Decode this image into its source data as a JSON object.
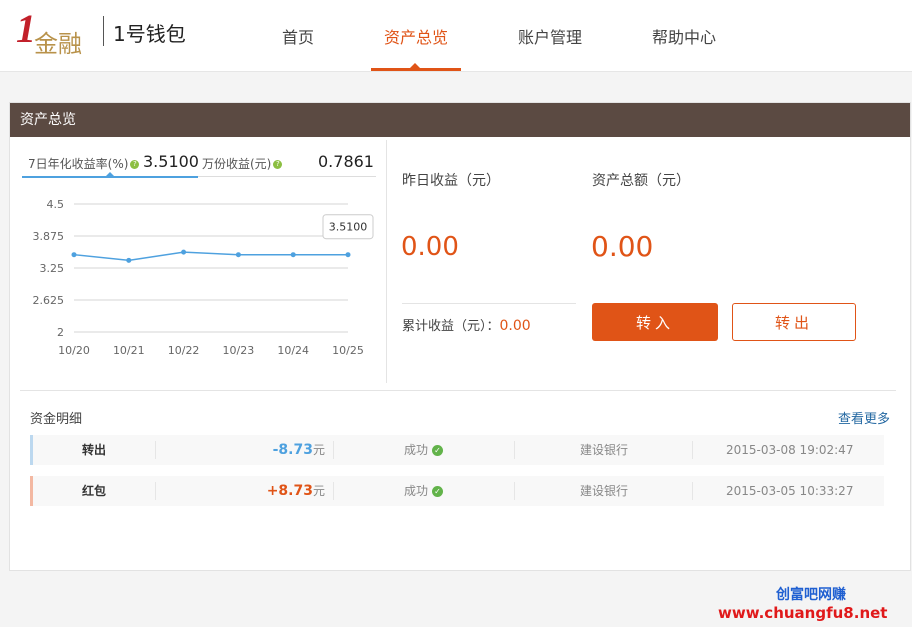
{
  "header": {
    "logo_text": "1金融",
    "brand": "1号钱包",
    "nav": [
      {
        "label": "首页",
        "active": false
      },
      {
        "label": "资产总览",
        "active": true
      },
      {
        "label": "账户管理",
        "active": false
      },
      {
        "label": "帮助中心",
        "active": false
      }
    ]
  },
  "panel": {
    "title": "资产总览",
    "yield_tab": {
      "label": "7日年化收益率(%)",
      "value": "3.5100"
    },
    "income_tab": {
      "label": "万份收益(元)",
      "value": "0.7861"
    },
    "yesterday_label": "昨日收益（元）",
    "yesterday_value": "0.00",
    "total_label": "资产总额（元）",
    "total_value": "0.00",
    "accum_label": "累计收益（元）：",
    "accum_value": "0.00",
    "btn_in": "转入",
    "btn_out": "转出"
  },
  "chart_data": {
    "type": "line",
    "x": [
      "10/20",
      "10/21",
      "10/22",
      "10/23",
      "10/24",
      "10/25"
    ],
    "series": [
      {
        "values": [
          3.51,
          3.4,
          3.56,
          3.51,
          3.51,
          3.51
        ]
      }
    ],
    "yticks": [
      "4.5",
      "3.875",
      "3.25",
      "2.625",
      "2"
    ],
    "ylim": [
      2,
      4.5
    ],
    "tooltip": "3.5100",
    "grid": true,
    "line_color": "#4ea1df"
  },
  "details": {
    "title": "资金明细",
    "more": "查看更多",
    "rows": [
      {
        "type": "转出",
        "amount": "-8.73",
        "unit": "元",
        "status": "成功",
        "bank": "建设银行",
        "time": "2015-03-08 19:02:47",
        "color": "#4ea1df",
        "bar": "#bcd8ef"
      },
      {
        "type": "红包",
        "amount": "+8.73",
        "unit": "元",
        "status": "成功",
        "bank": "建设银行",
        "time": "2015-03-05 10:33:27",
        "color": "#e05417",
        "bar": "#f3b8a2"
      }
    ]
  },
  "watermark": {
    "line1": "创富吧网赚",
    "line2": "www.chuangfu8.net"
  }
}
